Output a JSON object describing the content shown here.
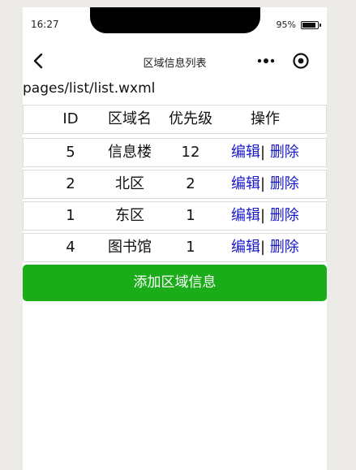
{
  "status_bar": {
    "time": "16:27",
    "battery_percent": "95%"
  },
  "nav_bar": {
    "title": "区域信息列表"
  },
  "page_path": "pages/list/list.wxml",
  "table": {
    "headers": {
      "id": "ID",
      "name": "区域名",
      "priority": "优先级",
      "action": "操作"
    },
    "rows": [
      {
        "id": "5",
        "name": "信息楼",
        "priority": "12",
        "edit": "编辑",
        "sep": "|",
        "delete": "删除"
      },
      {
        "id": "2",
        "name": "北区",
        "priority": "2",
        "edit": "编辑",
        "sep": "|",
        "delete": "删除"
      },
      {
        "id": "1",
        "name": "东区",
        "priority": "1",
        "edit": "编辑",
        "sep": "|",
        "delete": "删除"
      },
      {
        "id": "4",
        "name": "图书馆",
        "priority": "1",
        "edit": "编辑",
        "sep": "|",
        "delete": "删除"
      }
    ]
  },
  "add_button_label": "添加区域信息",
  "colors": {
    "primary": "#1aad19",
    "link": "#1818c8"
  }
}
